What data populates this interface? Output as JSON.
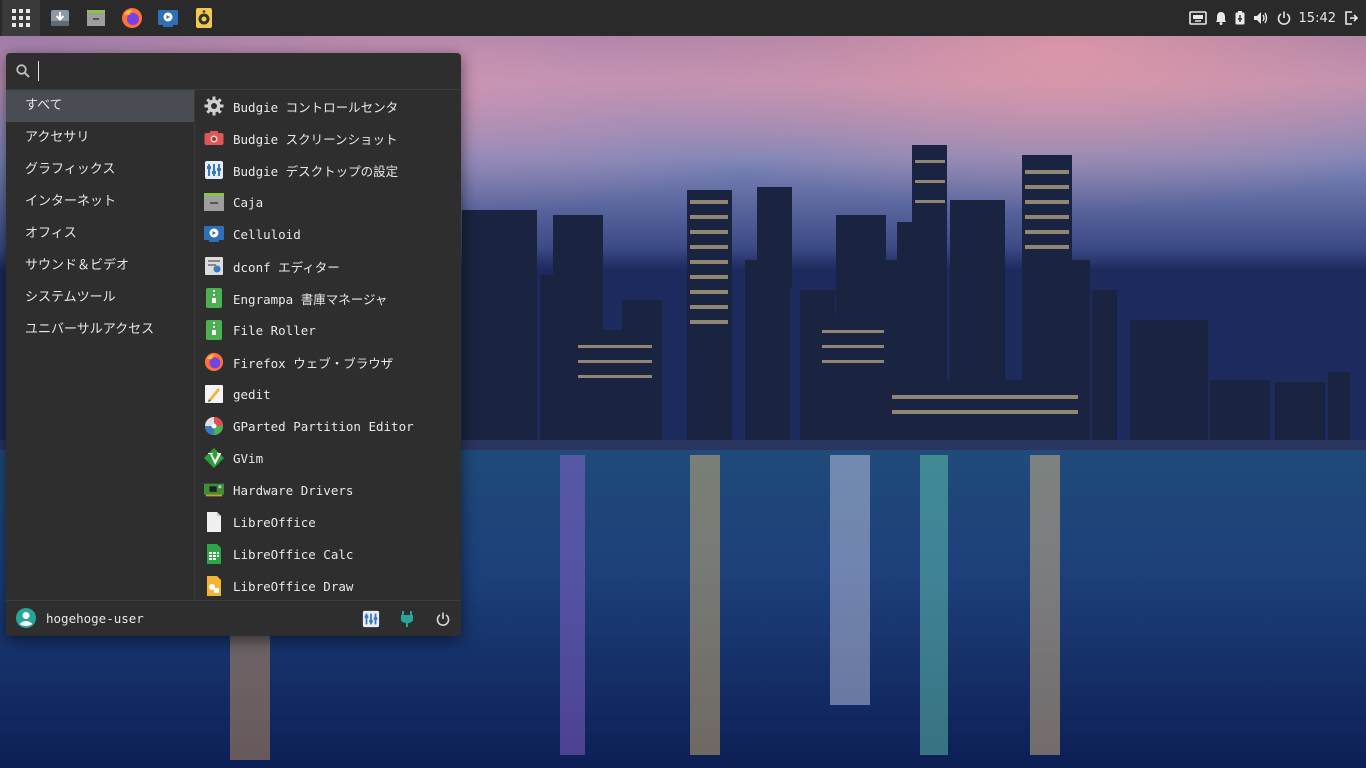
{
  "panel": {
    "launchers": [
      {
        "name": "download-icon"
      },
      {
        "name": "caja-icon"
      },
      {
        "name": "firefox-icon"
      },
      {
        "name": "celluloid-icon"
      },
      {
        "name": "speaker-app-icon"
      }
    ],
    "tray": {
      "clock": "15:42"
    }
  },
  "menu": {
    "search": {
      "placeholder": "",
      "value": ""
    },
    "categories": [
      {
        "label": "すべて",
        "active": true
      },
      {
        "label": "アクセサリ"
      },
      {
        "label": "グラフィックス"
      },
      {
        "label": "インターネット"
      },
      {
        "label": "オフィス"
      },
      {
        "label": "サウンド＆ビデオ"
      },
      {
        "label": "システムツール"
      },
      {
        "label": "ユニバーサルアクセス"
      }
    ],
    "apps": [
      {
        "label": "Budgie コントロールセンタ",
        "icon": "gear-icon"
      },
      {
        "label": "Budgie スクリーンショット",
        "icon": "camera-icon"
      },
      {
        "label": "Budgie デスクトップの設定",
        "icon": "desktop-settings-icon"
      },
      {
        "label": "Caja",
        "icon": "file-manager-icon"
      },
      {
        "label": "Celluloid",
        "icon": "video-player-icon"
      },
      {
        "label": "dconf エディター",
        "icon": "dconf-icon"
      },
      {
        "label": "Engrampa 書庫マネージャ",
        "icon": "archive-icon"
      },
      {
        "label": "File Roller",
        "icon": "archive-icon"
      },
      {
        "label": "Firefox ウェブ・ブラウザ",
        "icon": "firefox-icon"
      },
      {
        "label": "gedit",
        "icon": "text-editor-icon"
      },
      {
        "label": "GParted Partition Editor",
        "icon": "gparted-icon"
      },
      {
        "label": "GVim",
        "icon": "vim-icon"
      },
      {
        "label": "Hardware Drivers",
        "icon": "hardware-board-icon"
      },
      {
        "label": "LibreOffice",
        "icon": "document-icon"
      },
      {
        "label": "LibreOffice Calc",
        "icon": "spreadsheet-icon"
      },
      {
        "label": "LibreOffice Draw",
        "icon": "draw-icon"
      }
    ],
    "footer": {
      "username": "hogehoge-user"
    }
  }
}
